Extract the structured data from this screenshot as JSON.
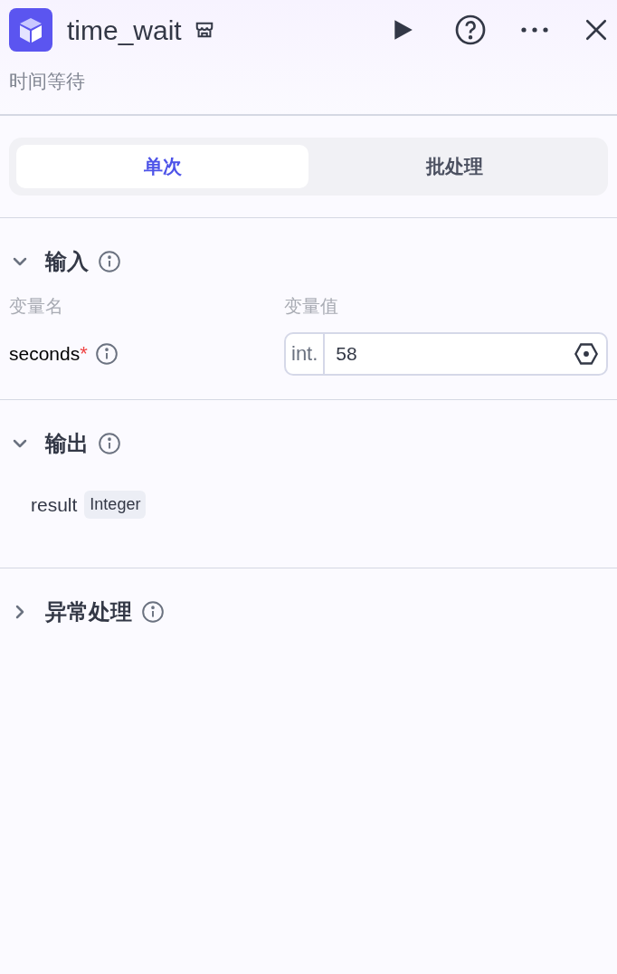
{
  "header": {
    "title": "time_wait",
    "subtitle": "时间等待"
  },
  "tabs": [
    {
      "label": "单次",
      "selected": true
    },
    {
      "label": "批处理",
      "selected": false
    }
  ],
  "sections": [
    {
      "kind": "input",
      "title": "输入",
      "expanded": true,
      "columns": [
        "变量名",
        "变量值"
      ],
      "rows": [
        {
          "name": "seconds",
          "required": true,
          "required_mark": "*",
          "type": "int.",
          "value": "58"
        }
      ]
    },
    {
      "kind": "output",
      "title": "输出",
      "expanded": true,
      "items": [
        {
          "name": "result",
          "type": "Integer"
        }
      ]
    },
    {
      "kind": "plain",
      "title": "异常处理",
      "expanded": false
    }
  ]
}
